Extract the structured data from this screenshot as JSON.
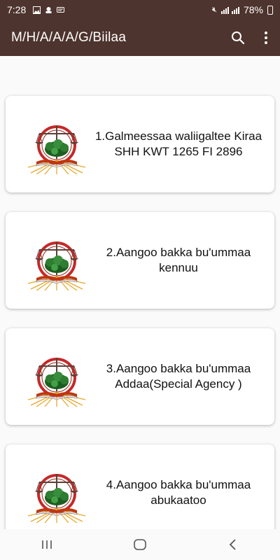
{
  "status_bar": {
    "time": "7:28",
    "battery": "78%"
  },
  "app_bar": {
    "title": "M/H/A/A/A/G/Biilaa",
    "icons": [
      "search-icon",
      "more-vert-icon"
    ]
  },
  "items": [
    {
      "label": "1.Galmeessaa waliigaltee Kiraa SHH KWT 1265 FI 2896"
    },
    {
      "label": "2.Aangoo bakka bu'ummaa kennuu"
    },
    {
      "label": "3.Aangoo bakka bu'ummaa Addaa(Special Agency )"
    },
    {
      "label": "4.Aangoo bakka bu'ummaa abukaatoo"
    }
  ],
  "colors": {
    "app_bar": "#4e342e",
    "background": "#fafafa",
    "card": "#ffffff"
  }
}
